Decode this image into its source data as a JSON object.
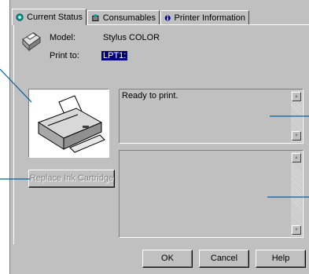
{
  "tabs": [
    {
      "label": "Current Status",
      "icon": "status-icon"
    },
    {
      "label": "Consumables",
      "icon": "consumables-icon"
    },
    {
      "label": "Printer Information",
      "icon": "info-icon"
    }
  ],
  "model": {
    "label": "Model:",
    "value": "Stylus COLOR"
  },
  "print_to": {
    "label": "Print to:",
    "value": "LPT1:"
  },
  "status_text": "Ready to print.",
  "replace_ink_button": "Replace Ink Cartridge",
  "buttons": {
    "ok": "OK",
    "cancel": "Cancel",
    "help": "Help"
  },
  "colors": {
    "face": "#c0c0c0",
    "highlight": "#000080",
    "callout": "#0060a0"
  }
}
